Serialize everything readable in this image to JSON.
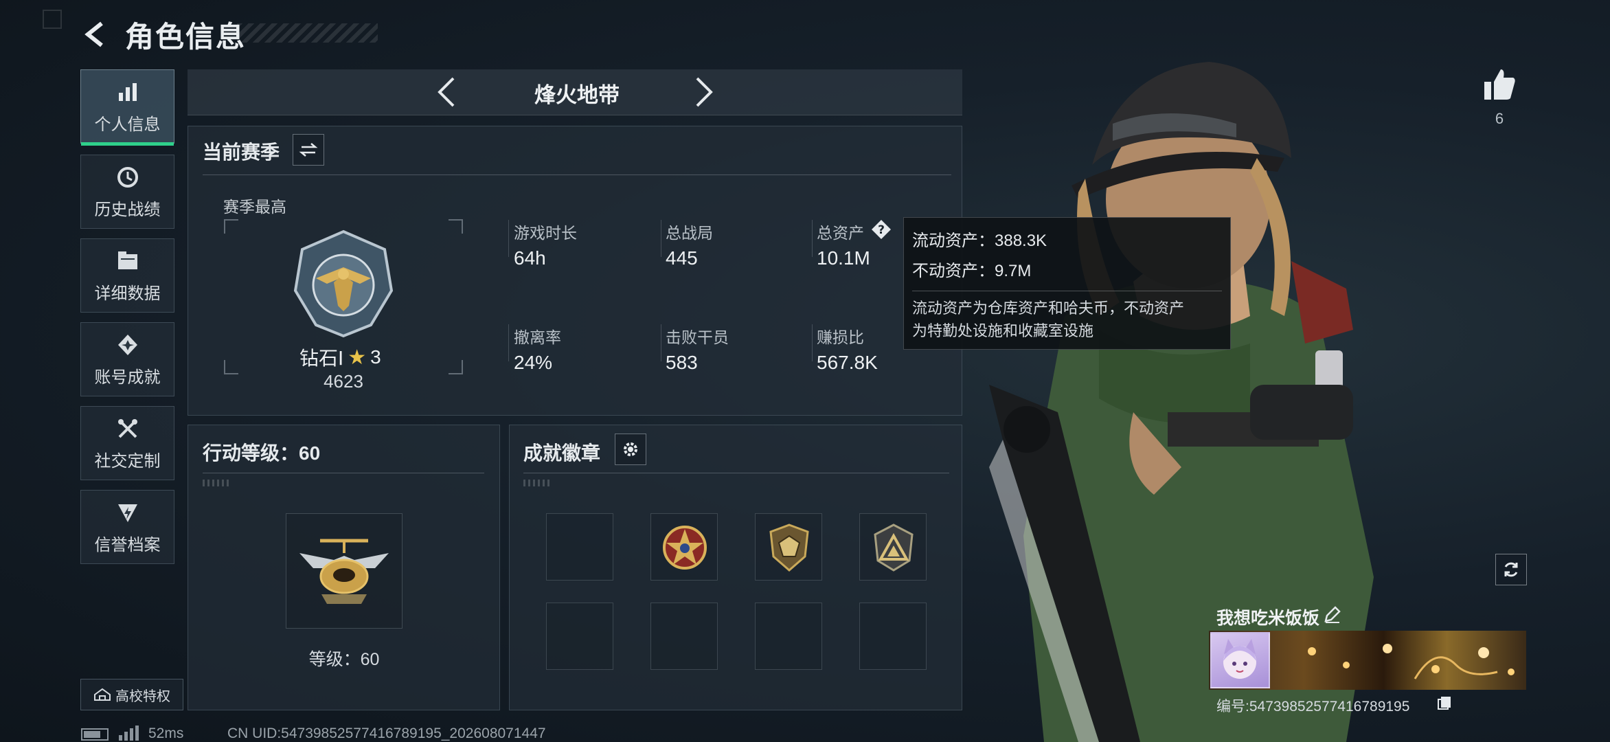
{
  "header": {
    "title": "角色信息"
  },
  "nav": {
    "items": [
      {
        "label": "个人信息",
        "icon": "bar-chart-icon",
        "active": true
      },
      {
        "label": "历史战绩",
        "icon": "history-clock-icon",
        "active": false
      },
      {
        "label": "详细数据",
        "icon": "folder-icon",
        "active": false
      },
      {
        "label": "账号成就",
        "icon": "achievement-icon",
        "active": false
      },
      {
        "label": "社交定制",
        "icon": "tools-icon",
        "active": false
      },
      {
        "label": "信誉档案",
        "icon": "shield-bolt-icon",
        "active": false
      }
    ],
    "campus_label": "高校特权"
  },
  "map": {
    "name": "烽火地带"
  },
  "season": {
    "title": "当前赛季",
    "best_label": "赛季最高",
    "rank_name": "钻石Ⅰ",
    "rank_stars": "3",
    "rank_points": "4623",
    "stats": [
      {
        "label": "游戏时长",
        "value": "64h"
      },
      {
        "label": "总战局",
        "value": "445"
      },
      {
        "label": "总资产",
        "value": "10.1M"
      },
      {
        "label": "撤离率",
        "value": "24%"
      },
      {
        "label": "击败干员",
        "value": "583"
      },
      {
        "label": "赚损比",
        "value": "567.8K"
      }
    ]
  },
  "tooltip": {
    "liquid": "流动资产：388.3K",
    "fixed": "不动资产：9.7M",
    "desc_line1": "流动资产为仓库资产和哈夫币，不动资产",
    "desc_line2": "为特勤处设施和收藏室设施"
  },
  "action_level": {
    "title": "行动等级：60",
    "level_text": "等级：60"
  },
  "badges": {
    "title": "成就徽章"
  },
  "player": {
    "like_count": "6",
    "name": "我想吃米饭饭",
    "id_text": "编号:5473985257741678919​5"
  },
  "status": {
    "ping": "52ms",
    "uid": "CN UID:547398525774167891​95_202608071447"
  },
  "colors": {
    "accent": "#2fd08b",
    "panel": "#24303a",
    "background": "#16202a"
  }
}
